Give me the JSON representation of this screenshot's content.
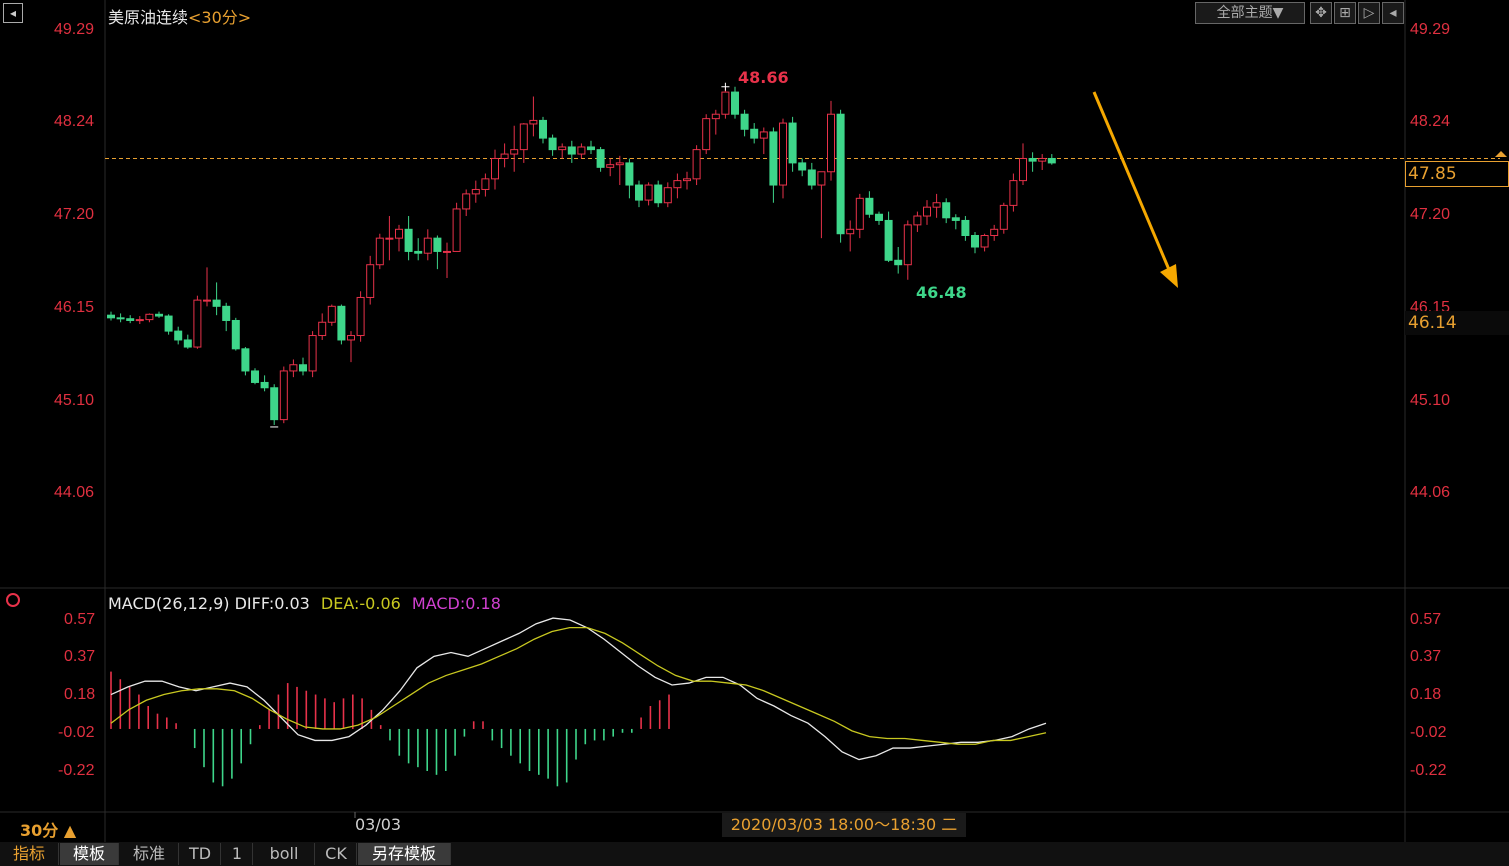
{
  "header": {
    "title": "美原油连续",
    "period": "<30分>",
    "theme_button": "全部主题▼"
  },
  "price_panel": {
    "left_axis_labels": [
      "49.29",
      "48.24",
      "47.20",
      "46.15",
      "45.10",
      "44.06"
    ],
    "right_axis_labels": [
      "49.29",
      "48.24",
      "47.20",
      "46.15",
      "45.10",
      "44.06"
    ],
    "current_price_label": "47.85",
    "cursor_price_label": "46.14",
    "high_label": "48.66",
    "low_label": "46.48"
  },
  "macd_panel": {
    "title": "MACD(26,12,9)",
    "diff_text": "DIFF:0.03",
    "dea_text": "DEA:-0.06",
    "macd_text": "MACD:0.18",
    "axis_labels": [
      "0.57",
      "0.37",
      "0.18",
      "-0.02",
      "-0.22"
    ]
  },
  "time_axis": {
    "period_label": "30分 ▲",
    "date_label": "03/03",
    "cursor_time": "2020/03/03 18:00～18:30 二"
  },
  "tabs": [
    "指标",
    "模板",
    "标准",
    "TD",
    "1",
    "boll",
    "CK",
    "另存模板"
  ],
  "colors": {
    "up": "#e8324a",
    "down": "#3ed68a",
    "axis_text": "#e03040",
    "dashed_line": "#e8a030",
    "dea_line": "#c8c820",
    "diff_line": "#e8e8e8",
    "arrow": "#f5a800",
    "macd_label": "#d040d0"
  },
  "chart_data": {
    "type": "candlestick",
    "price_axis": {
      "min": 44.06,
      "max": 49.29
    },
    "reference_price": 47.85,
    "candles": [
      [
        46.08,
        46.12,
        46.02,
        46.05
      ],
      [
        46.05,
        46.1,
        46.0,
        46.04
      ],
      [
        46.04,
        46.08,
        45.99,
        46.02
      ],
      [
        46.02,
        46.07,
        45.98,
        46.03
      ],
      [
        46.03,
        46.1,
        46.0,
        46.09
      ],
      [
        46.09,
        46.12,
        46.05,
        46.07
      ],
      [
        46.07,
        46.09,
        45.86,
        45.9
      ],
      [
        45.9,
        45.95,
        45.75,
        45.8
      ],
      [
        45.8,
        45.86,
        45.7,
        45.72
      ],
      [
        45.72,
        46.3,
        45.7,
        46.25
      ],
      [
        46.25,
        46.62,
        46.18,
        46.25
      ],
      [
        46.25,
        46.45,
        46.08,
        46.18
      ],
      [
        46.18,
        46.22,
        45.9,
        46.02
      ],
      [
        46.02,
        46.05,
        45.68,
        45.7
      ],
      [
        45.7,
        45.72,
        45.4,
        45.45
      ],
      [
        45.45,
        45.48,
        45.3,
        45.32
      ],
      [
        45.32,
        45.4,
        45.22,
        45.26
      ],
      [
        45.26,
        45.3,
        44.84,
        44.9
      ],
      [
        44.9,
        45.5,
        44.86,
        45.45
      ],
      [
        45.45,
        45.58,
        45.38,
        45.52
      ],
      [
        45.52,
        45.6,
        45.4,
        45.45
      ],
      [
        45.45,
        45.9,
        45.38,
        45.85
      ],
      [
        45.85,
        46.1,
        45.8,
        46.0
      ],
      [
        46.0,
        46.2,
        45.96,
        46.18
      ],
      [
        46.18,
        46.2,
        45.75,
        45.8
      ],
      [
        45.8,
        45.9,
        45.55,
        45.85
      ],
      [
        45.85,
        46.35,
        45.78,
        46.28
      ],
      [
        46.28,
        46.75,
        46.2,
        46.65
      ],
      [
        46.65,
        47.0,
        46.6,
        46.95
      ],
      [
        46.95,
        47.2,
        46.7,
        46.95
      ],
      [
        46.95,
        47.1,
        46.8,
        47.05
      ],
      [
        47.05,
        47.2,
        46.7,
        46.8
      ],
      [
        46.8,
        46.95,
        46.7,
        46.78
      ],
      [
        46.78,
        47.05,
        46.7,
        46.95
      ],
      [
        46.95,
        46.98,
        46.6,
        46.8
      ],
      [
        46.8,
        46.9,
        46.5,
        46.8
      ],
      [
        46.8,
        47.35,
        46.8,
        47.28
      ],
      [
        47.28,
        47.5,
        47.2,
        47.45
      ],
      [
        47.45,
        47.6,
        47.35,
        47.5
      ],
      [
        47.5,
        47.68,
        47.42,
        47.62
      ],
      [
        47.62,
        47.95,
        47.5,
        47.85
      ],
      [
        47.85,
        48.02,
        47.75,
        47.9
      ],
      [
        47.9,
        48.22,
        47.7,
        47.95
      ],
      [
        47.95,
        48.25,
        47.8,
        48.24
      ],
      [
        48.24,
        48.55,
        48.1,
        48.28
      ],
      [
        48.28,
        48.32,
        48.02,
        48.08
      ],
      [
        48.08,
        48.12,
        47.88,
        47.95
      ],
      [
        47.95,
        48.02,
        47.85,
        47.98
      ],
      [
        47.98,
        48.05,
        47.8,
        47.9
      ],
      [
        47.9,
        48.02,
        47.85,
        47.98
      ],
      [
        47.98,
        48.05,
        47.9,
        47.95
      ],
      [
        47.95,
        47.98,
        47.7,
        47.75
      ],
      [
        47.75,
        47.85,
        47.65,
        47.78
      ],
      [
        47.78,
        47.88,
        47.55,
        47.8
      ],
      [
        47.8,
        47.85,
        47.4,
        47.55
      ],
      [
        47.55,
        47.6,
        47.3,
        47.38
      ],
      [
        47.38,
        47.58,
        47.32,
        47.55
      ],
      [
        47.55,
        47.6,
        47.3,
        47.35
      ],
      [
        47.35,
        47.58,
        47.3,
        47.52
      ],
      [
        47.52,
        47.68,
        47.4,
        47.6
      ],
      [
        47.6,
        47.7,
        47.5,
        47.62
      ],
      [
        47.62,
        48.0,
        47.55,
        47.95
      ],
      [
        47.95,
        48.35,
        47.9,
        48.3
      ],
      [
        48.3,
        48.4,
        48.12,
        48.35
      ],
      [
        48.35,
        48.66,
        48.3,
        48.6
      ],
      [
        48.6,
        48.66,
        48.3,
        48.35
      ],
      [
        48.35,
        48.4,
        48.1,
        48.18
      ],
      [
        48.18,
        48.25,
        48.02,
        48.08
      ],
      [
        48.08,
        48.2,
        47.9,
        48.15
      ],
      [
        48.15,
        48.2,
        47.35,
        47.55
      ],
      [
        47.55,
        48.3,
        47.4,
        48.25
      ],
      [
        48.25,
        48.32,
        47.7,
        47.8
      ],
      [
        47.8,
        47.85,
        47.65,
        47.72
      ],
      [
        47.72,
        47.8,
        47.5,
        47.55
      ],
      [
        47.55,
        47.7,
        46.95,
        47.7
      ],
      [
        47.7,
        48.5,
        47.6,
        48.35
      ],
      [
        48.35,
        48.4,
        46.9,
        47.0
      ],
      [
        47.0,
        47.15,
        46.8,
        47.05
      ],
      [
        47.05,
        47.45,
        46.95,
        47.4
      ],
      [
        47.4,
        47.48,
        47.18,
        47.22
      ],
      [
        47.22,
        47.25,
        47.1,
        47.15
      ],
      [
        47.15,
        47.25,
        46.68,
        46.7
      ],
      [
        46.7,
        46.85,
        46.55,
        46.65
      ],
      [
        46.65,
        47.15,
        46.48,
        47.1
      ],
      [
        47.1,
        47.25,
        47.02,
        47.2
      ],
      [
        47.2,
        47.38,
        47.1,
        47.3
      ],
      [
        47.3,
        47.45,
        47.18,
        47.35
      ],
      [
        47.35,
        47.4,
        47.12,
        47.18
      ],
      [
        47.18,
        47.22,
        47.05,
        47.15
      ],
      [
        47.15,
        47.2,
        46.92,
        46.98
      ],
      [
        46.98,
        47.02,
        46.78,
        46.85
      ],
      [
        46.85,
        47.0,
        46.8,
        46.98
      ],
      [
        46.98,
        47.1,
        46.92,
        47.05
      ],
      [
        47.05,
        47.35,
        47.0,
        47.32
      ],
      [
        47.32,
        47.68,
        47.25,
        47.6
      ],
      [
        47.6,
        48.02,
        47.55,
        47.85
      ],
      [
        47.85,
        47.92,
        47.7,
        47.82
      ],
      [
        47.82,
        47.9,
        47.72,
        47.85
      ],
      [
        47.85,
        47.9,
        47.78,
        47.8
      ]
    ],
    "macd": {
      "axis": {
        "min": -0.3,
        "max": 0.62
      },
      "diff": [
        0.18,
        0.22,
        0.25,
        0.25,
        0.22,
        0.2,
        0.22,
        0.24,
        0.22,
        0.15,
        0.06,
        -0.03,
        -0.06,
        -0.06,
        -0.04,
        0.02,
        0.1,
        0.2,
        0.32,
        0.38,
        0.4,
        0.38,
        0.42,
        0.46,
        0.5,
        0.55,
        0.58,
        0.57,
        0.53,
        0.47,
        0.4,
        0.33,
        0.27,
        0.23,
        0.24,
        0.27,
        0.27,
        0.23,
        0.16,
        0.12,
        0.07,
        0.03,
        -0.04,
        -0.12,
        -0.16,
        -0.14,
        -0.1,
        -0.1,
        -0.09,
        -0.08,
        -0.07,
        -0.07,
        -0.06,
        -0.04,
        0.0,
        0.03
      ],
      "dea": [
        0.03,
        0.1,
        0.15,
        0.18,
        0.2,
        0.21,
        0.21,
        0.2,
        0.16,
        0.1,
        0.05,
        0.01,
        0.0,
        0.0,
        0.02,
        0.06,
        0.12,
        0.18,
        0.24,
        0.28,
        0.31,
        0.34,
        0.38,
        0.42,
        0.47,
        0.51,
        0.53,
        0.53,
        0.5,
        0.45,
        0.39,
        0.33,
        0.28,
        0.25,
        0.25,
        0.24,
        0.23,
        0.2,
        0.16,
        0.12,
        0.08,
        0.04,
        -0.01,
        -0.04,
        -0.05,
        -0.05,
        -0.06,
        -0.07,
        -0.08,
        -0.08,
        -0.06,
        -0.06,
        -0.04,
        -0.02
      ],
      "hist": [
        0.3,
        0.26,
        0.22,
        0.18,
        0.12,
        0.08,
        0.06,
        0.03,
        0.0,
        -0.1,
        -0.2,
        -0.28,
        -0.3,
        -0.26,
        -0.18,
        -0.08,
        0.02,
        0.1,
        0.18,
        0.24,
        0.22,
        0.2,
        0.18,
        0.16,
        0.14,
        0.16,
        0.18,
        0.16,
        0.1,
        0.02,
        -0.06,
        -0.14,
        -0.18,
        -0.2,
        -0.22,
        -0.24,
        -0.22,
        -0.14,
        -0.04,
        0.04,
        0.04,
        -0.06,
        -0.1,
        -0.14,
        -0.18,
        -0.22,
        -0.24,
        -0.26,
        -0.3,
        -0.28,
        -0.16,
        -0.08,
        -0.06,
        -0.06,
        -0.04,
        -0.02,
        -0.02,
        0.06,
        0.12,
        0.15,
        0.18
      ]
    }
  }
}
